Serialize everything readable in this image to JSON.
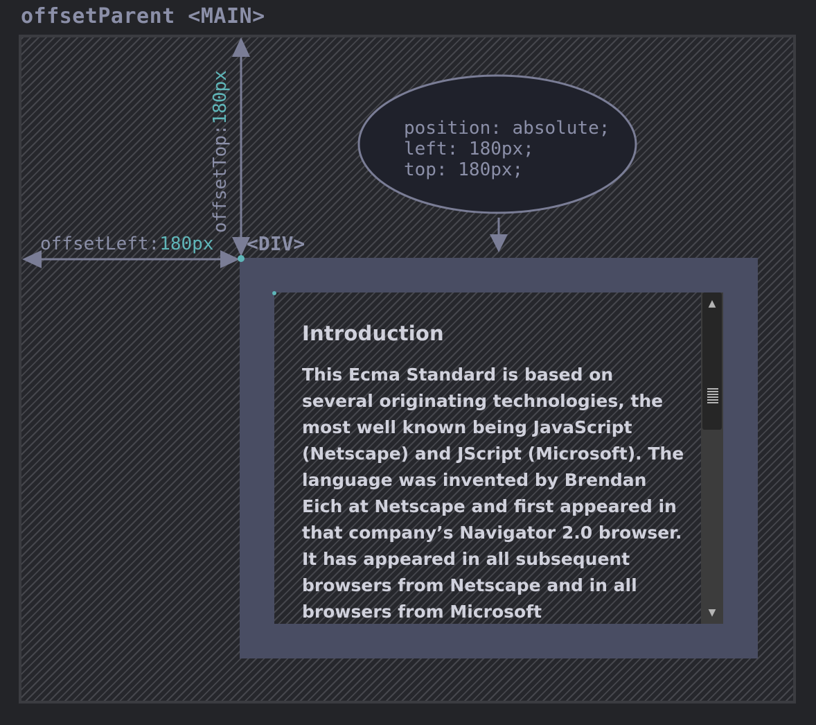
{
  "main_label": "offsetParent <MAIN>",
  "div_label": "<DIV>",
  "offset_left": {
    "name": "offsetLeft:",
    "value": "180px"
  },
  "offset_top": {
    "name": "offsetTop:",
    "value": "180px"
  },
  "css_note": {
    "line1": "position: absolute;",
    "line2": "left: 180px;",
    "line3": "top: 180px;"
  },
  "content": {
    "heading": "Introduction",
    "paragraph": "This Ecma Standard is based on several originating technologies, the most well known being JavaScript (Netscape) and JScript (Microsoft). The language was invented by Brendan Eich at Netscape and first appeared in that company’s Navigator 2.0 browser. It has appeared in all subsequent browsers from Netscape and in all browsers from Microsoft"
  },
  "scrollbar": {
    "up_arrow": "▲",
    "down_arrow": "▼"
  },
  "colors": {
    "background": "#232428",
    "hatch": "#46474d",
    "arrow": "#7a7d96",
    "label_gray": "#8b8fa8",
    "value_teal": "#5fb6b9",
    "div_border": "#494d63",
    "ellipse_fill": "#1f212b",
    "text_light": "#d0d1dc"
  }
}
